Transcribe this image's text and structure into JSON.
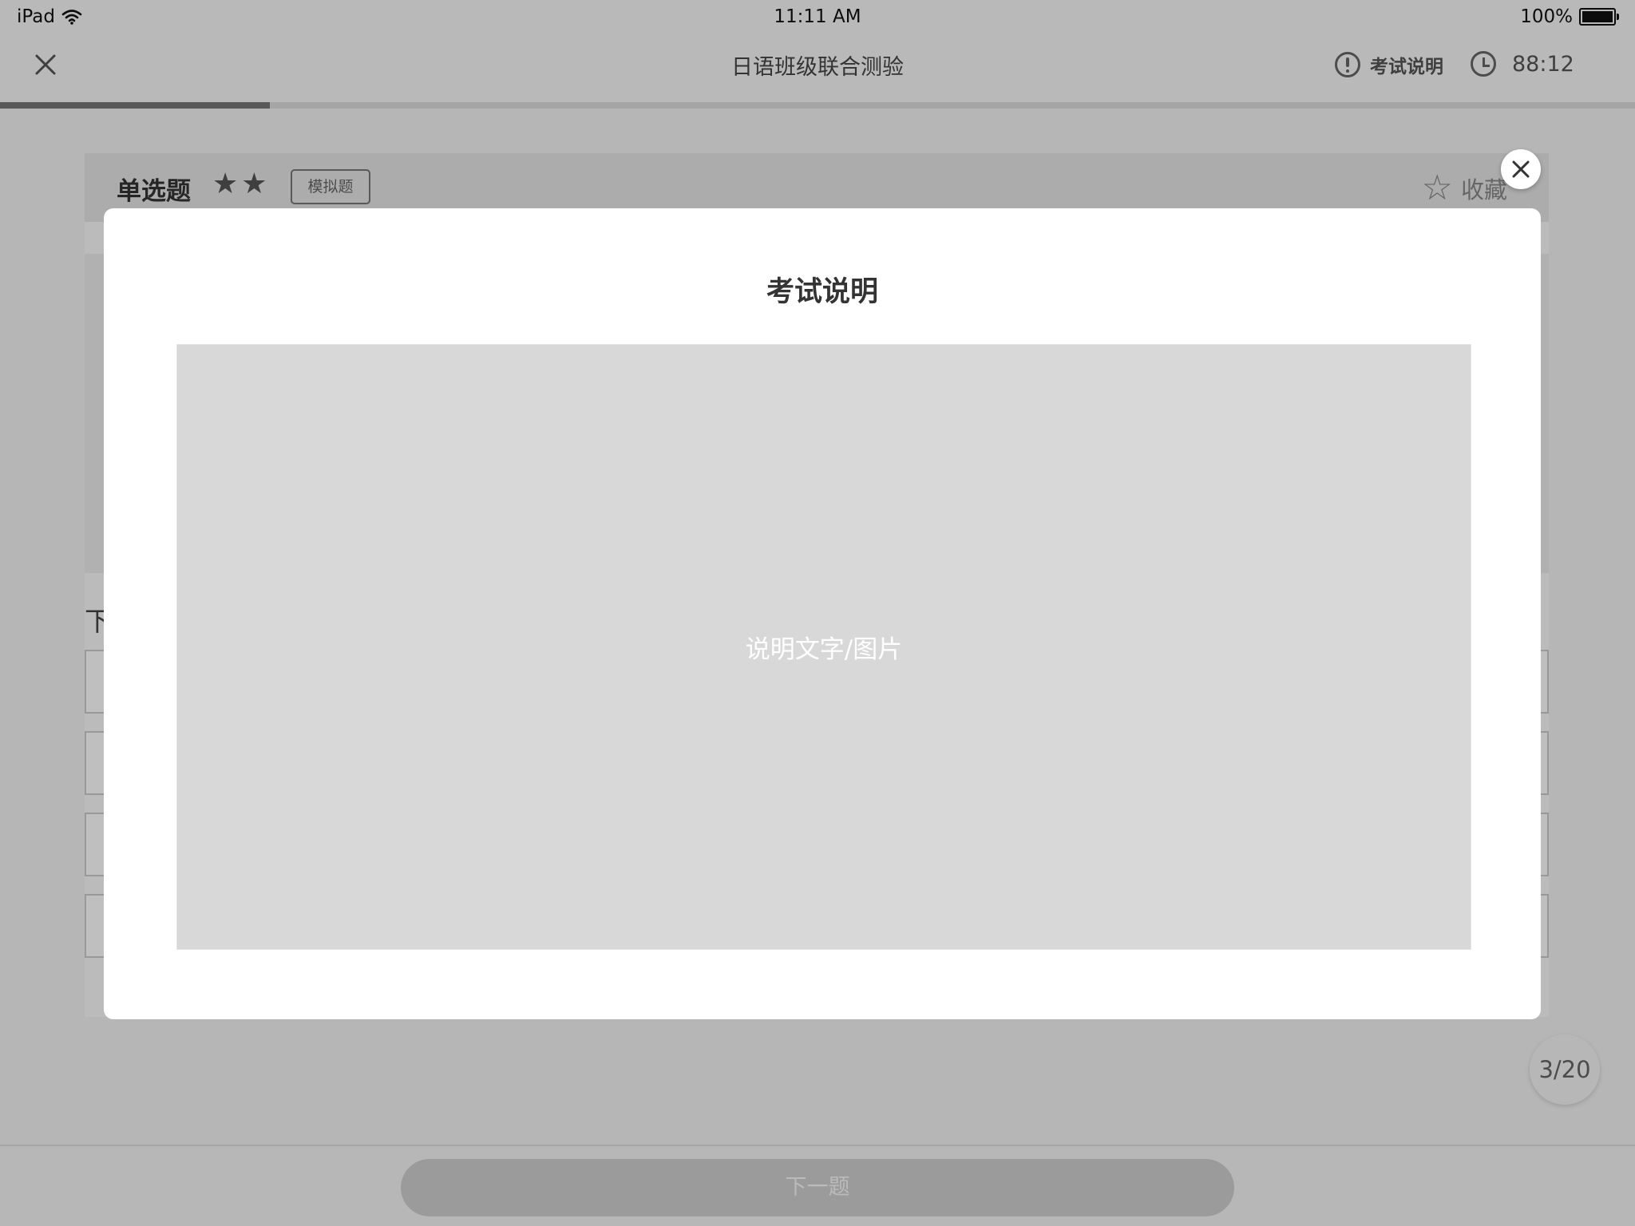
{
  "status_bar": {
    "device": "iPad",
    "time": "11:11 AM",
    "battery": "100%"
  },
  "nav": {
    "title": "日语班级联合测验",
    "exam_info_label": "考试说明",
    "timer": "88:12"
  },
  "progress": {
    "fraction": 0.165
  },
  "question": {
    "type_label": "单选题",
    "difficulty_stars": 2,
    "tag": "模拟题",
    "favorite_label": "收藏",
    "prompt_start": "下"
  },
  "footer": {
    "next_label": "下一题",
    "counter": "3/20"
  },
  "modal": {
    "title": "考试说明",
    "placeholder": "说明文字/图片"
  },
  "icons": {
    "close": "close-icon",
    "wifi": "wifi-icon",
    "info": "info-icon",
    "clock": "clock-icon",
    "star": "star-icon"
  }
}
